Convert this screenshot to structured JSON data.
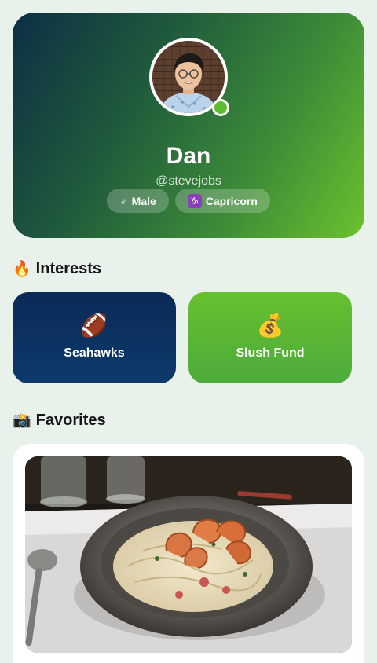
{
  "profile": {
    "name": "Dan",
    "handle": "@stevejobs",
    "gender_chip": {
      "icon": "male-sign-icon",
      "glyph": "♂",
      "label": "Male"
    },
    "zodiac_chip": {
      "icon": "capricorn-icon",
      "glyph": "♑",
      "label": "Capricorn"
    },
    "online": true,
    "colors": {
      "online": "#5bbd2f",
      "gradient_start": "#0c2f45",
      "gradient_end": "#6cc12d"
    }
  },
  "interests": {
    "title_icon": "fire-icon",
    "title_emoji": "🔥",
    "title": "Interests",
    "items": [
      {
        "icon": "football-icon",
        "emoji": "🏈",
        "label": "Seahawks",
        "color": "#0a2a56"
      },
      {
        "icon": "money-bag-icon",
        "emoji": "💰",
        "label": "Slush Fund",
        "color": "#5cb534"
      }
    ]
  },
  "favorites": {
    "title_icon": "camera-icon",
    "title_emoji": "📸",
    "title": "Favorites",
    "photos": [
      {
        "subject": "shrimp-pasta-photo"
      }
    ]
  }
}
